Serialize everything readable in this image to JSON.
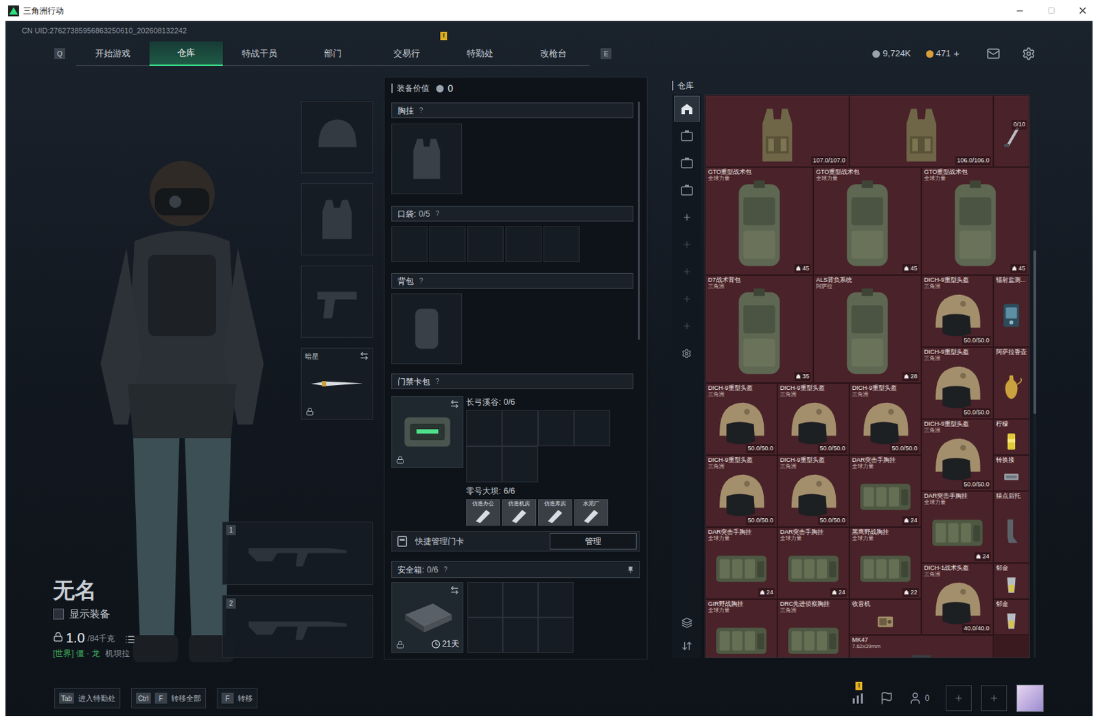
{
  "window": {
    "title": "三角洲行动"
  },
  "uid": "CN UID:27627385956863250610_202608132242",
  "nav": {
    "left_key": "Q",
    "right_key": "E",
    "tabs": [
      {
        "label": "开始游戏",
        "selected": false,
        "alert": ""
      },
      {
        "label": "仓库",
        "selected": true,
        "alert": ""
      },
      {
        "label": "特战干员",
        "selected": false,
        "alert": ""
      },
      {
        "label": "部门",
        "selected": false,
        "alert": ""
      },
      {
        "label": "交易行",
        "selected": false,
        "alert": ""
      },
      {
        "label": "特勤处",
        "selected": false,
        "alert": "!"
      },
      {
        "label": "改枪台",
        "selected": false,
        "alert": ""
      }
    ]
  },
  "currency": [
    {
      "kind": "silver",
      "value": "9,724K",
      "action": ""
    },
    {
      "kind": "gold",
      "value": "471",
      "action": "+"
    }
  ],
  "character": {
    "name": "无名",
    "show_equipment": {
      "label": "显示装备",
      "checked": false
    },
    "weight": "1.0",
    "weight_max": "/84千克",
    "channel": "[世界] 僵 · 龙",
    "title": "机坝拉"
  },
  "gear_slots": [
    {
      "kind": "helmet",
      "label": "",
      "locked": false
    },
    {
      "kind": "armor",
      "label": "",
      "locked": false
    },
    {
      "kind": "pistol",
      "label": "",
      "locked": false
    },
    {
      "kind": "melee",
      "label": "暗星",
      "locked": true
    }
  ],
  "weapon_slots": [
    {
      "number": "1"
    },
    {
      "number": "2"
    }
  ],
  "loadout": {
    "value_label": "装备价值",
    "value": "0",
    "chest": {
      "label": "胸挂",
      "help": "?"
    },
    "pockets": {
      "label": "口袋:",
      "count": "0/5",
      "help": "?",
      "slots": [
        {
          "filled": false
        },
        {
          "filled": false
        },
        {
          "filled": false
        },
        {
          "filled": false
        },
        {
          "filled": false
        }
      ]
    },
    "backpack": {
      "label": "背包",
      "help": "?"
    },
    "keycards": {
      "label": "门禁卡包",
      "help": "?",
      "locked": true,
      "maps": [
        {
          "name": "长弓溪谷:",
          "count": "0/6",
          "slots": [
            {
              "filled": false
            },
            {
              "filled": false
            },
            {
              "filled": false
            },
            {
              "filled": false
            },
            {
              "filled": false
            },
            {
              "filled": false
            }
          ],
          "cards": []
        },
        {
          "name": "零号大坝:",
          "count": "6/6",
          "slots": [],
          "cards": [
            {
              "label": "仿造办公"
            },
            {
              "label": "仿造机房"
            },
            {
              "label": "仿造库房"
            },
            {
              "label": "水泥厂"
            }
          ]
        }
      ]
    },
    "quick": {
      "label": "快捷管理门卡",
      "button": "管理"
    },
    "safebox": {
      "label": "安全箱:",
      "count": "0/6",
      "help": "?",
      "days": "21天",
      "locked": true,
      "slots": [
        {
          "filled": false
        },
        {
          "filled": false
        },
        {
          "filled": false
        },
        {
          "filled": false
        },
        {
          "filled": false
        },
        {
          "filled": false
        }
      ]
    }
  },
  "warehouse": {
    "title": "仓库",
    "sidebar": [
      {
        "kind": "home",
        "selected": true,
        "disabled": false
      },
      {
        "kind": "case",
        "selected": false,
        "disabled": false
      },
      {
        "kind": "case",
        "selected": false,
        "disabled": false
      },
      {
        "kind": "case",
        "selected": false,
        "disabled": false
      },
      {
        "kind": "add",
        "selected": false,
        "disabled": false
      },
      {
        "kind": "add",
        "selected": false,
        "disabled": true
      },
      {
        "kind": "add",
        "selected": false,
        "disabled": true
      },
      {
        "kind": "add",
        "selected": false,
        "disabled": true
      },
      {
        "kind": "add",
        "selected": false,
        "disabled": true
      },
      {
        "kind": "settings",
        "selected": false,
        "disabled": false
      }
    ],
    "sidebar_bottom": [
      {
        "kind": "layers"
      },
      {
        "kind": "sort"
      }
    ],
    "items": [
      {
        "kind": "armor",
        "name": "",
        "origin": "",
        "durability": "107.0/107.0"
      },
      {
        "kind": "armor",
        "name": "",
        "origin": "",
        "durability": "106.0/106.0"
      },
      {
        "kind": "tool",
        "name": "",
        "origin": "",
        "capacity": "0/10"
      },
      {
        "kind": "backpack",
        "name": "GTO重型战术包",
        "origin": "全球力量",
        "count": "45"
      },
      {
        "kind": "backpack",
        "name": "GTO重型战术包",
        "origin": "全球力量",
        "count": "45"
      },
      {
        "kind": "backpack",
        "name": "GTO重型战术包",
        "origin": "全球力量",
        "count": "45"
      },
      {
        "kind": "backpack",
        "name": "D7战术背包",
        "origin": "三角洲",
        "count": "35"
      },
      {
        "kind": "backpack",
        "name": "ALS背负系统",
        "origin": "阿萨拉",
        "count": "28"
      },
      {
        "kind": "helmet",
        "name": "DICH-9重型头盔",
        "origin": "三角洲",
        "durability": "50.0/50.0"
      },
      {
        "kind": "device",
        "name": "辐射监测...",
        "origin": ""
      },
      {
        "kind": "helmet",
        "name": "DICH-9重型头盔",
        "origin": "三角洲",
        "durability": "50.0/50.0"
      },
      {
        "kind": "vase",
        "name": "阿萨拉香壶",
        "origin": ""
      },
      {
        "kind": "helmet",
        "name": "DICH-9重型头盔",
        "origin": "三角洲",
        "durability": "50.0/50.0"
      },
      {
        "kind": "helmet",
        "name": "DICH-9重型头盔",
        "origin": "三角洲",
        "durability": "50.0/50.0"
      },
      {
        "kind": "helmet",
        "name": "DICH-9重型头盔",
        "origin": "三角洲",
        "durability": "50.0/50.0"
      },
      {
        "kind": "helmet",
        "name": "DICH-9重型头盔",
        "origin": "三角洲",
        "durability": "50.0/50.0"
      },
      {
        "kind": "can",
        "name": "柠檬",
        "origin": ""
      },
      {
        "kind": "part",
        "name": "转换接",
        "origin": ""
      },
      {
        "kind": "helmet",
        "name": "DICH-9重型头盔",
        "origin": "三角洲",
        "durability": "50.0/50.0"
      },
      {
        "kind": "helmet",
        "name": "DICH-9重型头盔",
        "origin": "三角洲",
        "durability": "50.0/50.0"
      },
      {
        "kind": "rig",
        "name": "DAR突击手胸挂",
        "origin": "全球力量",
        "count": "24"
      },
      {
        "kind": "rig",
        "name": "DAR突击手胸挂",
        "origin": "全球力量",
        "count": "24"
      },
      {
        "kind": "stock",
        "name": "猎点后托",
        "origin": ""
      },
      {
        "kind": "rig",
        "name": "DAR突击手胸挂",
        "origin": "全球力量",
        "count": "24"
      },
      {
        "kind": "rig",
        "name": "DAR突击手胸挂",
        "origin": "全球力量",
        "count": "24"
      },
      {
        "kind": "rig",
        "name": "黑鹰野战胸挂",
        "origin": "全球力量",
        "count": "22"
      },
      {
        "kind": "helmet",
        "name": "DICH-1战术头盔",
        "origin": "三角洲",
        "durability": "40.0/40.0"
      },
      {
        "kind": "drink",
        "name": "郁金",
        "origin": ""
      },
      {
        "kind": "drink",
        "name": "郁金",
        "origin": ""
      },
      {
        "kind": "rig",
        "name": "GIR野战胸挂",
        "origin": "全球力量"
      },
      {
        "kind": "rig",
        "name": "DRC先进侦察胸挂",
        "origin": "三角洲"
      },
      {
        "kind": "radio",
        "name": "收音机",
        "origin": ""
      },
      {
        "kind": "weapon",
        "name": "MK47",
        "origin": "7.62x39mm"
      }
    ]
  },
  "bottom_bar": {
    "hints": [
      {
        "keys": [
          "Tab"
        ],
        "label": "进入特勤处"
      },
      {
        "keys": [
          "Ctrl",
          "F"
        ],
        "label": "转移全部"
      },
      {
        "keys": [
          "F"
        ],
        "label": "转移"
      }
    ],
    "stats_alert": "!",
    "friends": "0"
  }
}
